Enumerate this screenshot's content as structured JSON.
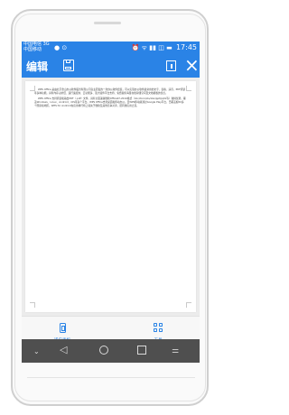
{
  "status_bar": {
    "carrier_line1": "中国电信 3G",
    "carrier_line2": "中国移动",
    "left_icons": "● ⊙",
    "right_icons": "⏰ ᯤ ▮▮ ◫",
    "battery": "▬",
    "time": "17:45"
  },
  "toolbar": {
    "edit_label": "编辑"
  },
  "document": {
    "paragraphs": [
      "WPS Office 是由北京金山办公软件股份有限公司自主研发的一款办公软件套装，可以实现办公软件最常用的文字、表格、演示，PDF阅读等多种功能。具有内存占用低、运行速度快、云功能多、强大插件平台支持、免费提供海量在线存储空间及文档模板的优点。",
      "WPS Office 支持阅读和输出PDF（.pdf）文件、具有全面兼容微软Office97-2010格式（doc/docx/xls/xlsx/ppt/pptx等）独特优势。覆盖Windows、Linux、Android、iOS等多个平台。WPS Office支持桌面和移动办公。且WPS移动版通过Google Play平台，已覆盖超50多个国家和地区。WPS for Android在应用排行榜上领先于微软及其他竞争对手，居同类应用之首。"
    ]
  },
  "bottom_bar": {
    "left_label": "适应手机",
    "right_label": "工具"
  },
  "nav_bar": {
    "down": "⌄",
    "back": "◁",
    "menu": "⚌"
  }
}
